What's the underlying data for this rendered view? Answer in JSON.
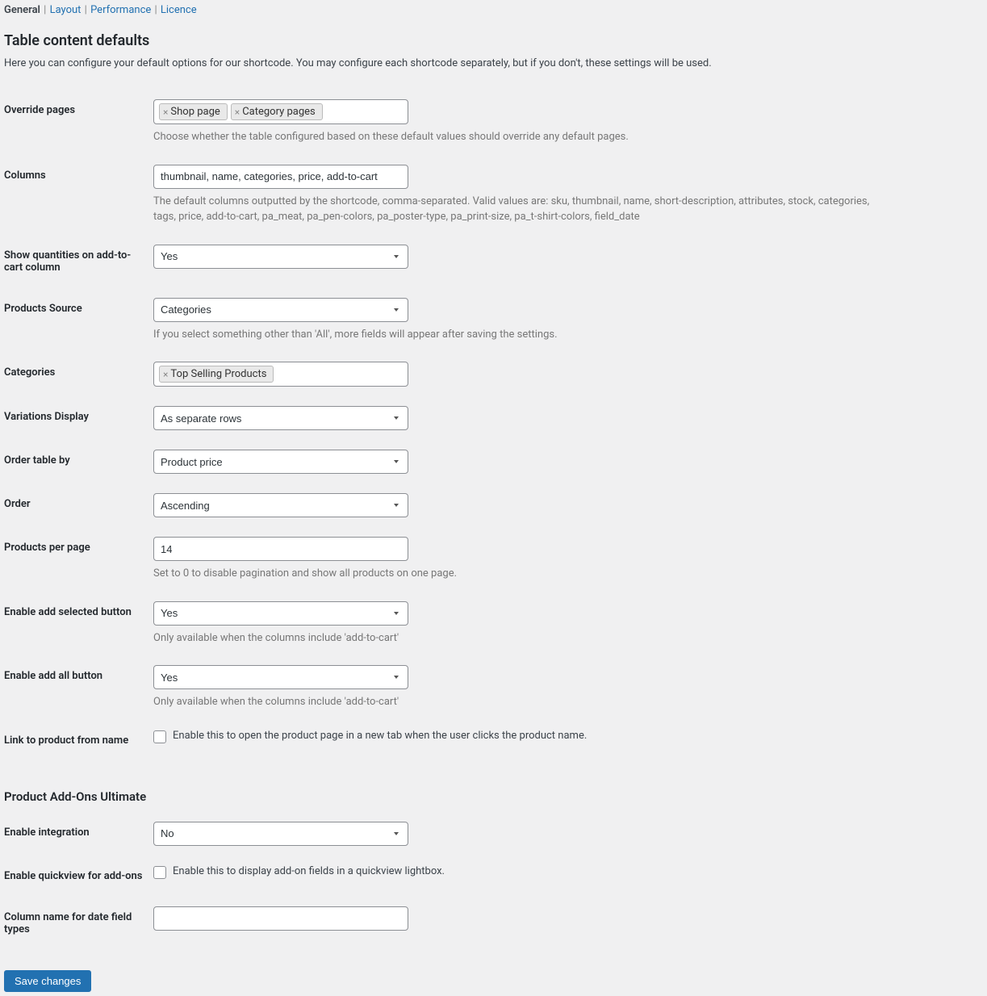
{
  "tabs": {
    "general": "General",
    "layout": "Layout",
    "performance": "Performance",
    "licence": "Licence"
  },
  "heading": "Table content defaults",
  "intro": "Here you can configure your default options for our shortcode. You may configure each shortcode separately, but if you don't, these settings will be used.",
  "override_pages": {
    "label": "Override pages",
    "tags": [
      "Shop page",
      "Category pages"
    ],
    "description": "Choose whether the table configured based on these default values should override any default pages."
  },
  "columns": {
    "label": "Columns",
    "value": "thumbnail, name, categories, price, add-to-cart",
    "description": "The default columns outputted by the shortcode, comma-separated. Valid values are: sku, thumbnail, name, short-description, attributes, stock, categories, tags, price, add-to-cart, pa_meat, pa_pen-colors, pa_poster-type, pa_print-size, pa_t-shirt-colors, field_date"
  },
  "show_quantities": {
    "label": "Show quantities on add-to-cart column",
    "value": "Yes"
  },
  "products_source": {
    "label": "Products Source",
    "value": "Categories",
    "description": "If you select something other than 'All', more fields will appear after saving the settings."
  },
  "categories": {
    "label": "Categories",
    "tags": [
      "Top Selling Products"
    ]
  },
  "variations_display": {
    "label": "Variations Display",
    "value": "As separate rows"
  },
  "order_by": {
    "label": "Order table by",
    "value": "Product price"
  },
  "order": {
    "label": "Order",
    "value": "Ascending"
  },
  "products_per_page": {
    "label": "Products per page",
    "value": "14",
    "description": "Set to 0 to disable pagination and show all products on one page."
  },
  "enable_add_selected": {
    "label": "Enable add selected button",
    "value": "Yes",
    "description": "Only available when the columns include 'add-to-cart'"
  },
  "enable_add_all": {
    "label": "Enable add all button",
    "value": "Yes",
    "description": "Only available when the columns include 'add-to-cart'"
  },
  "link_to_product": {
    "label": "Link to product from name",
    "checkbox_label": "Enable this to open the product page in a new tab when the user clicks the product name."
  },
  "addons_heading": "Product Add-Ons Ultimate",
  "enable_integration": {
    "label": "Enable integration",
    "value": "No"
  },
  "enable_quickview": {
    "label": "Enable quickview for add-ons",
    "checkbox_label": "Enable this to display add-on fields in a quickview lightbox."
  },
  "column_name_date": {
    "label": "Column name for date field types",
    "value": ""
  },
  "submit": "Save changes"
}
